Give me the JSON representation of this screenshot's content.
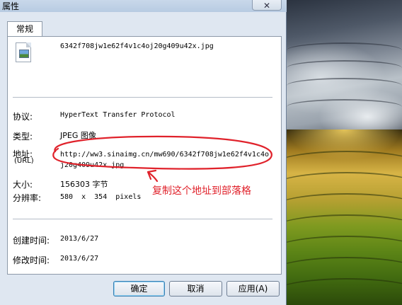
{
  "window": {
    "title": "属性",
    "close_glyph": "✕"
  },
  "tabs": [
    {
      "label": "常规"
    }
  ],
  "file": {
    "name": "6342f708jw1e62f4v1c4oj20g409u42x.jpg"
  },
  "fields": {
    "protocol_label": "协议:",
    "protocol_value": "HyperText Transfer Protocol",
    "type_label": "类型:",
    "type_value": "JPEG 图像",
    "address_label": "地址:",
    "address_sublabel": "(URL)",
    "address_value": "http://ww3.sinaimg.cn/mw690/6342f708jw1e62f4v1c4oj20g409u42x.jpg",
    "size_label": "大小:",
    "size_value": "156303 字节",
    "dimensions_label": "分辨率:",
    "dimensions_value": "580  x  354  pixels",
    "created_label": "创建时间:",
    "created_value": "2013/6/27",
    "modified_label": "修改时间:",
    "modified_value": "2013/6/27"
  },
  "buttons": {
    "ok": "确定",
    "cancel": "取消",
    "apply": "应用(A)"
  },
  "annotation": {
    "text": "复制这个地址到部落格",
    "color": "#e0222b"
  },
  "icons": {
    "file": "image-file-icon"
  }
}
